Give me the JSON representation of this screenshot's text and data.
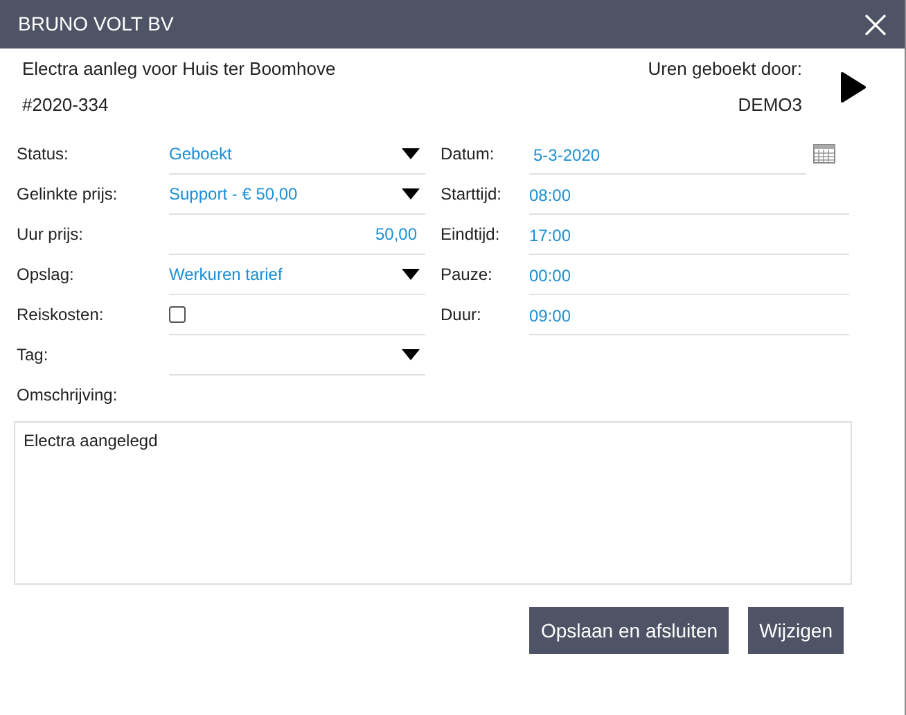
{
  "window": {
    "title": "BRUNO VOLT BV"
  },
  "header": {
    "project": "Electra aanleg voor Huis ter Boomhove",
    "number": "#2020-334",
    "booked_by_label": "Uren geboekt door:",
    "booked_by": "DEMO3"
  },
  "left_fields": [
    {
      "label": "Status:",
      "kind": "select",
      "value": "Geboekt"
    },
    {
      "label": "Gelinkte prijs:",
      "kind": "select",
      "value": "Support - € 50,00"
    },
    {
      "label": "Uur prijs:",
      "kind": "number",
      "value": "50,00"
    },
    {
      "label": "Opslag:",
      "kind": "select",
      "value": "Werkuren tarief"
    },
    {
      "label": "Reiskosten:",
      "kind": "checkbox",
      "checked": false
    },
    {
      "label": "Tag:",
      "kind": "select"
    }
  ],
  "right_fields": [
    {
      "label": "Datum:",
      "kind": "date",
      "value": "5-3-2020"
    },
    {
      "label": "Starttijd:",
      "kind": "time",
      "value": "08:00"
    },
    {
      "label": "Eindtijd:",
      "kind": "time",
      "value": "17:00"
    },
    {
      "label": "Pauze:",
      "kind": "time",
      "value": "00:00"
    },
    {
      "label": "Duur:",
      "kind": "time",
      "value": "09:00"
    }
  ],
  "description": {
    "label": "Omschrijving:",
    "value": "Electra aangelegd"
  },
  "buttons": [
    "Opslaan en afsluiten",
    "Wijzigen"
  ]
}
